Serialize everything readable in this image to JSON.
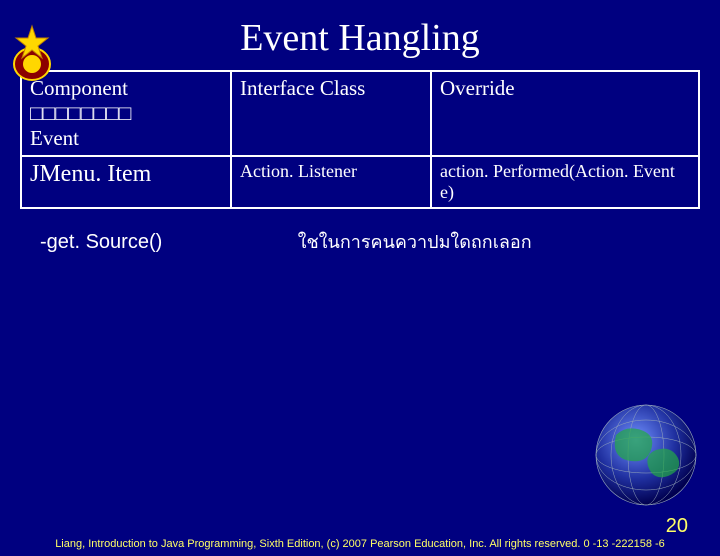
{
  "title": "Event Hangling",
  "table": {
    "headers": [
      "Component □□□□□□□□\nEvent",
      "Interface Class",
      "Override"
    ],
    "rows": [
      {
        "c0": "JMenu. Item",
        "c1": "Action. Listener",
        "c2": "action. Performed(Action. Event e)"
      }
    ]
  },
  "note": {
    "label": "-get. Source()",
    "desc": "ใชในการคนควาปมใดถกเลอก"
  },
  "footer": "Liang, Introduction to Java Programming, Sixth Edition, (c) 2007 Pearson Education, Inc. All rights reserved. 0 -13 -222158 -6",
  "page_number": "20"
}
